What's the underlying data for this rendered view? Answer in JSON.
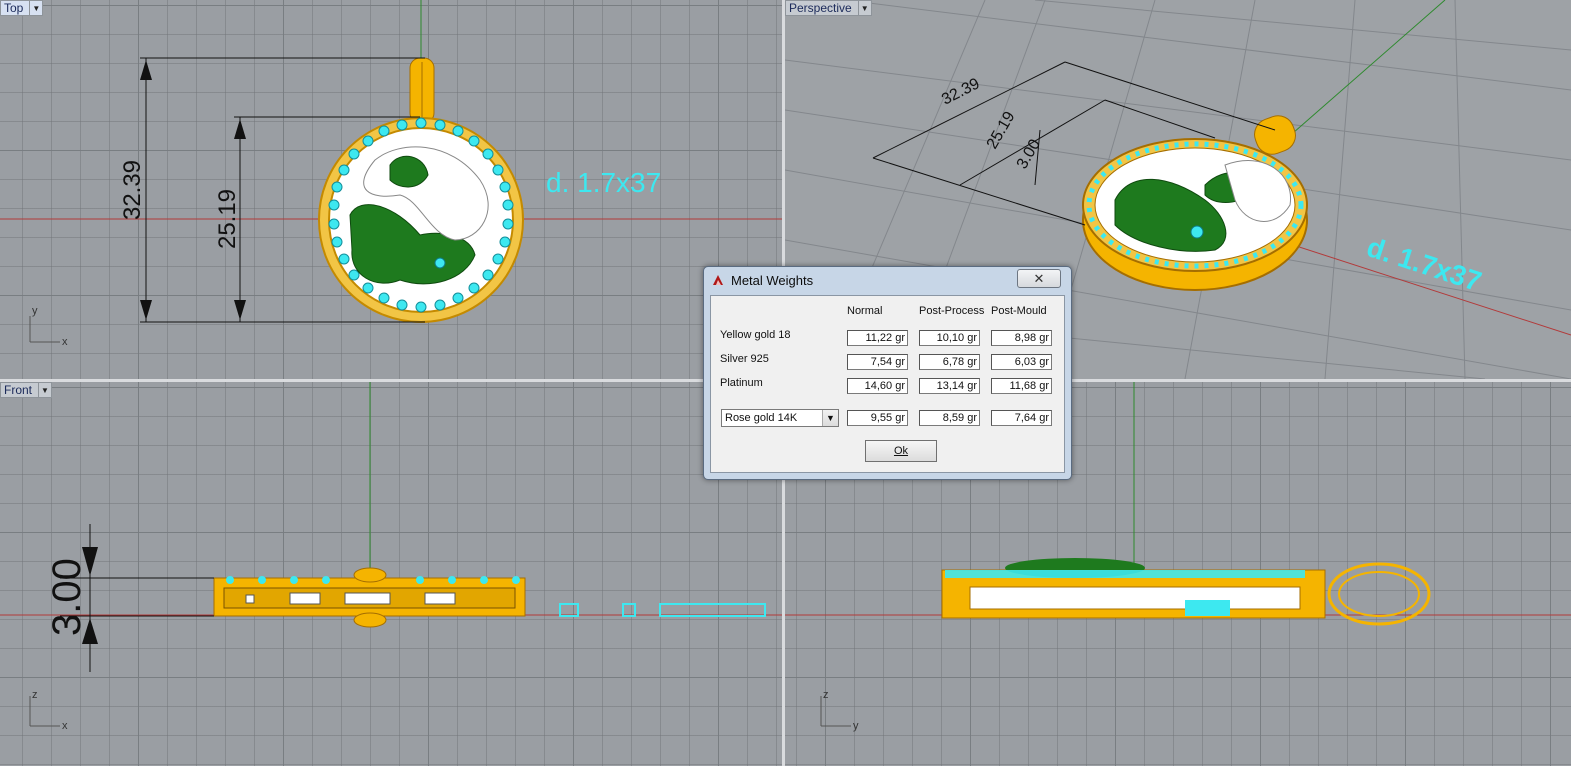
{
  "viewports": {
    "top": {
      "label": "Top",
      "dimensions": [
        "32.39",
        "25.19"
      ],
      "annotation": "d. 1.7x37",
      "axes": [
        "y",
        "x"
      ]
    },
    "perspective": {
      "label": "Perspective",
      "dimensions": [
        "32.39",
        "25.19",
        "3.00"
      ],
      "annotation": "d. 1.7x37"
    },
    "front": {
      "label": "Front",
      "dimensions": [
        "3.00"
      ],
      "axes": [
        "z",
        "x"
      ]
    },
    "right": {
      "label": "",
      "axes": [
        "z",
        "y"
      ]
    }
  },
  "dialog": {
    "title": "Metal Weights",
    "close_label": "✕",
    "columns": [
      "Normal",
      "Post-Process",
      "Post-Mould"
    ],
    "rows": [
      {
        "label": "Yellow gold 18",
        "values": [
          "11,22 gr",
          "10,10 gr",
          "8,98 gr"
        ]
      },
      {
        "label": "Silver 925",
        "values": [
          "7,54 gr",
          "6,78 gr",
          "6,03 gr"
        ]
      },
      {
        "label": "Platinum",
        "values": [
          "14,60 gr",
          "13,14 gr",
          "11,68 gr"
        ]
      }
    ],
    "custom_row": {
      "selected": "Rose gold 14K",
      "values": [
        "9,55 gr",
        "8,59 gr",
        "7,64 gr"
      ]
    },
    "ok_label": "Ok"
  },
  "colors": {
    "gold": "#f5b400",
    "cyan": "#3de8f0",
    "green": "#1e7a1e",
    "dim_line": "#111111"
  }
}
